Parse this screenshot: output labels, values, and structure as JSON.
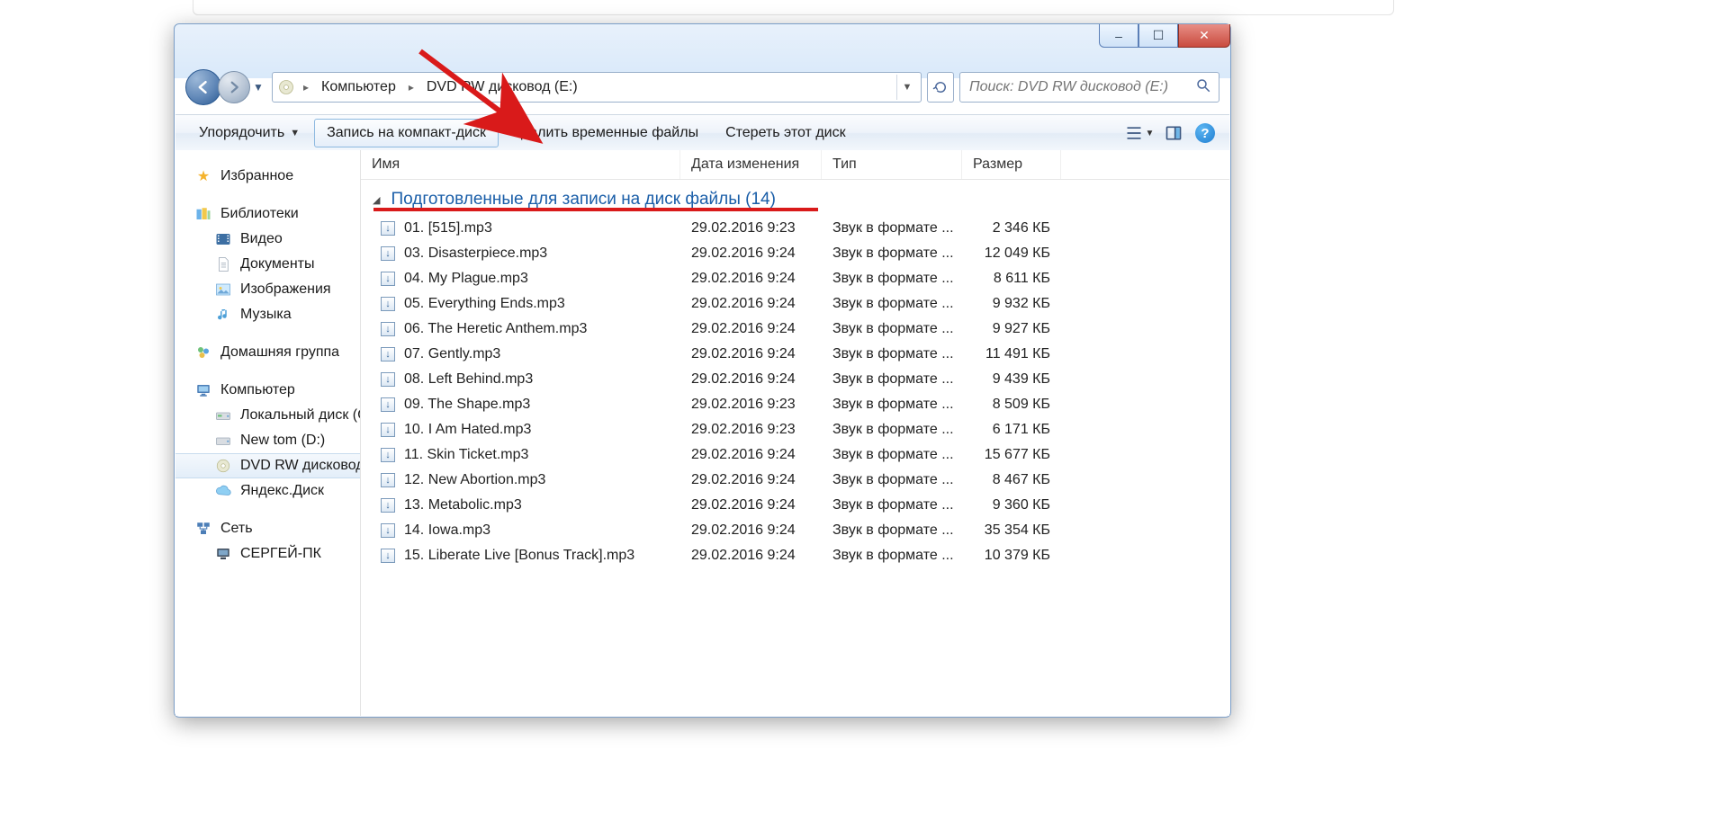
{
  "window": {
    "title_buttons": {
      "minimize": "–",
      "maximize": "☐",
      "close": "✕"
    }
  },
  "nav": {
    "breadcrumb": [
      {
        "label": "Компьютер"
      },
      {
        "label": "DVD RW дисковод (E:)"
      }
    ],
    "search_placeholder": "Поиск: DVD RW дисковод (E:)"
  },
  "toolbar": {
    "organize": "Упорядочить",
    "burn": "Запись на компакт-диск",
    "delete_temp": "Удалить временные файлы",
    "erase": "Стереть этот диск"
  },
  "columns": {
    "name": "Имя",
    "date": "Дата изменения",
    "type": "Тип",
    "size": "Размер"
  },
  "group_title": "Подготовленные для записи на диск файлы (14)",
  "sidebar": {
    "favorites": "Избранное",
    "libraries": "Библиотеки",
    "video": "Видео",
    "documents": "Документы",
    "images": "Изображения",
    "music": "Музыка",
    "homegroup": "Домашняя группа",
    "computer": "Компьютер",
    "local_c": "Локальный диск (C",
    "new_tom": "New tom (D:)",
    "dvd_rw": "DVD RW дисковод (",
    "yandex": "Яндекс.Диск",
    "network": "Сеть",
    "sergey_pc": "СЕРГЕЙ-ПК"
  },
  "file_type": "Звук в формате ...",
  "files": [
    {
      "name": "01. [515].mp3",
      "date": "29.02.2016 9:23",
      "size": "2 346 КБ"
    },
    {
      "name": "03. Disasterpiece.mp3",
      "date": "29.02.2016 9:24",
      "size": "12 049 КБ"
    },
    {
      "name": "04. My Plague.mp3",
      "date": "29.02.2016 9:24",
      "size": "8 611 КБ"
    },
    {
      "name": "05. Everything Ends.mp3",
      "date": "29.02.2016 9:24",
      "size": "9 932 КБ"
    },
    {
      "name": "06. The Heretic Anthem.mp3",
      "date": "29.02.2016 9:24",
      "size": "9 927 КБ"
    },
    {
      "name": "07. Gently.mp3",
      "date": "29.02.2016 9:24",
      "size": "11 491 КБ"
    },
    {
      "name": "08. Left Behind.mp3",
      "date": "29.02.2016 9:24",
      "size": "9 439 КБ"
    },
    {
      "name": "09. The Shape.mp3",
      "date": "29.02.2016 9:23",
      "size": "8 509 КБ"
    },
    {
      "name": "10. I Am Hated.mp3",
      "date": "29.02.2016 9:23",
      "size": "6 171 КБ"
    },
    {
      "name": "11. Skin Ticket.mp3",
      "date": "29.02.2016 9:24",
      "size": "15 677 КБ"
    },
    {
      "name": "12. New Abortion.mp3",
      "date": "29.02.2016 9:24",
      "size": "8 467 КБ"
    },
    {
      "name": "13. Metabolic.mp3",
      "date": "29.02.2016 9:24",
      "size": "9 360 КБ"
    },
    {
      "name": "14. Iowa.mp3",
      "date": "29.02.2016 9:24",
      "size": "35 354 КБ"
    },
    {
      "name": "15. Liberate Live [Bonus Track].mp3",
      "date": "29.02.2016 9:24",
      "size": "10 379 КБ"
    }
  ]
}
